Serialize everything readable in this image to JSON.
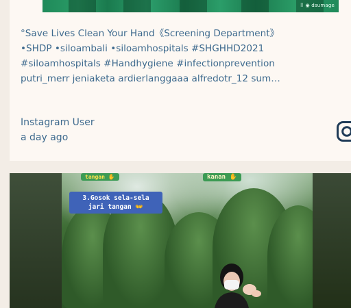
{
  "post1": {
    "watermark": "⠿ ◉ dsumage",
    "caption_lines": [
      "°Save Lives Clean Your Hand《Screening Department》",
      "•SHDP •siloambali •siloamhospitals #SHGHHD2021",
      "#siloamhospitals #Handhygiene #infectionprevention",
      "putri_merr jeniaketa ardierlanggaaa alfredotr_12 sum…"
    ],
    "author": "Instagram User",
    "time": "a day ago",
    "platform_icon": "instagram-icon"
  },
  "post2": {
    "overlay_top_left": "tangan ✋",
    "overlay_top_right": "kanan ✋",
    "overlay_step_line1": "3.Gosok sela-sela",
    "overlay_step_line2": "jari tangan 👐"
  },
  "colors": {
    "background": "#f3ede6",
    "card": "#fdf8f3",
    "text_link": "#3e6a8e"
  }
}
